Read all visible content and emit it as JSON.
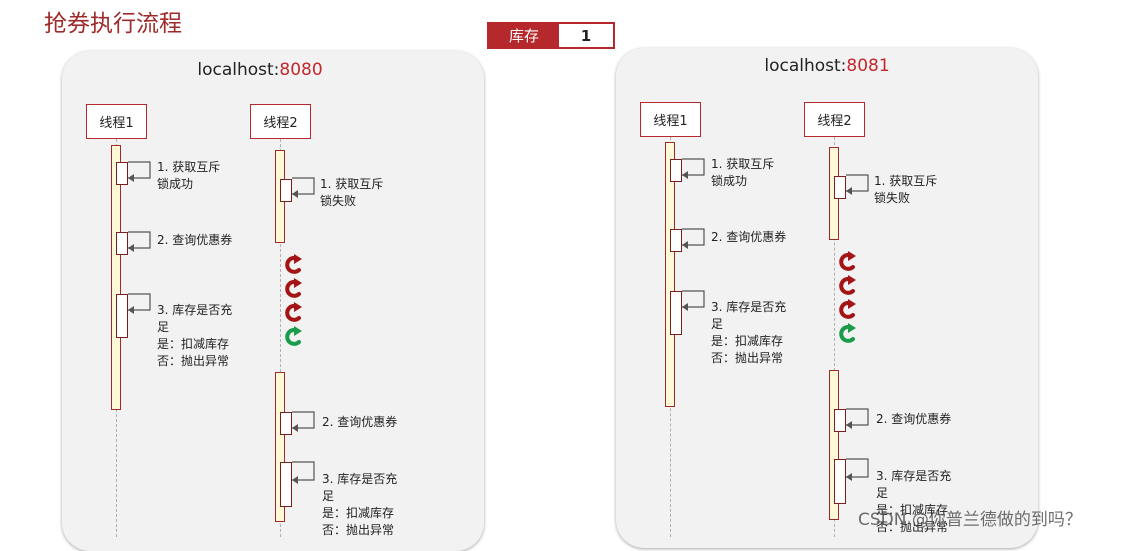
{
  "title": "抢券执行流程",
  "stock": {
    "label": "库存",
    "value": "1"
  },
  "servers": [
    {
      "host": "localhost:",
      "port": "8080",
      "thread1": {
        "label": "线程1",
        "steps": [
          "1. 获取互斥\n锁成功",
          "2. 查询优惠券",
          "3. 库存是否充\n足\n是：扣减库存\n否：抛出异常"
        ]
      },
      "thread2": {
        "label": "线程2",
        "steps": [
          "1. 获取互斥\n锁失败",
          "2. 查询优惠券",
          "3. 库存是否充\n足\n是：扣减库存\n否：抛出异常"
        ]
      }
    },
    {
      "host": "localhost:",
      "port": "8081",
      "thread1": {
        "label": "线程1",
        "steps": [
          "1. 获取互斥\n锁成功",
          "2. 查询优惠券",
          "3. 库存是否充\n足\n是：扣减库存\n否：抛出异常"
        ]
      },
      "thread2": {
        "label": "线程2",
        "steps": [
          "1. 获取互斥\n锁失败",
          "2. 查询优惠券",
          "3. 库存是否充\n足\n是：扣减库存\n否：抛出异常"
        ]
      }
    }
  ],
  "watermark": "CSDN @你普兰德做的到吗？",
  "colors": {
    "brand": "#b5282b",
    "retry_wait": "#a31515",
    "retry_success": "#1a9c4a",
    "activation": "#fff8d6"
  }
}
